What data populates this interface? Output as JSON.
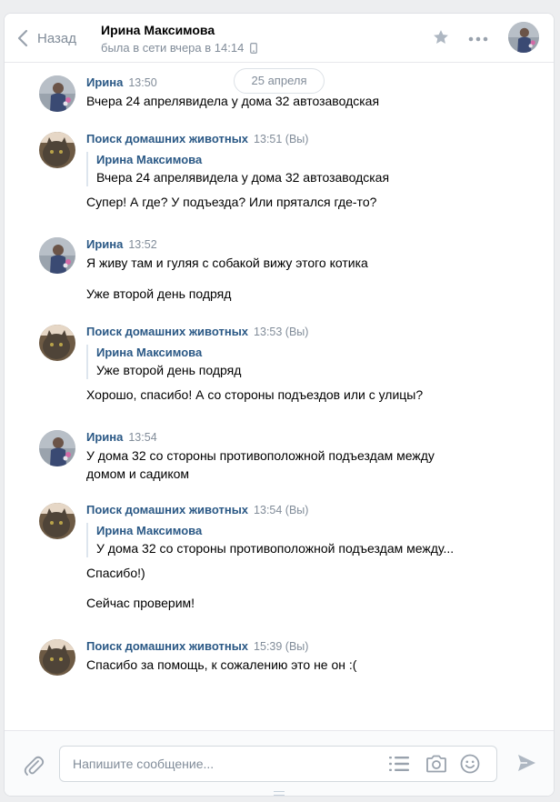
{
  "header": {
    "back_label": "Назад",
    "peer_name": "Ирина Максимова",
    "peer_status": "была в сети вчера в 14:14"
  },
  "history": {
    "date_label": "25 апреля",
    "messages": [
      {
        "author": "Ирина",
        "time": "13:50",
        "avatar": "user-photo",
        "lines": [
          "Вчера 24 апрелявидела у дома 32 автозаводская"
        ]
      },
      {
        "author": "Поиск домашних животных",
        "time": "13:51 (Вы)",
        "avatar": "cat-photo",
        "quote_author": "Ирина Максимова",
        "quote_text": "Вчера 24 апрелявидела у дома 32 автозаводская",
        "lines": [
          "Супер! А где? У подъезда? Или прятался где-то?"
        ]
      },
      {
        "author": "Ирина",
        "time": "13:52",
        "avatar": "user-photo",
        "lines": [
          "Я живу там и гуляя с собакой вижу этого котика",
          "Уже второй день подряд"
        ]
      },
      {
        "author": "Поиск домашних животных",
        "time": "13:53 (Вы)",
        "avatar": "cat-photo",
        "quote_author": "Ирина Максимова",
        "quote_text": "Уже второй день подряд",
        "lines": [
          "Хорошо, спасибо! А со стороны подъездов или с улицы?"
        ]
      },
      {
        "author": "Ирина",
        "time": "13:54",
        "avatar": "user-photo",
        "lines": [
          "У дома 32 со стороны противоположной подъездам между",
          "домом и садиком"
        ]
      },
      {
        "author": "Поиск домашних животных",
        "time": "13:54 (Вы)",
        "avatar": "cat-photo",
        "quote_author": "Ирина Максимова",
        "quote_text": "У дома 32 со стороны противоположной подъездам между...",
        "lines": [
          "Спасибо!)",
          "Сейчас проверим!"
        ]
      },
      {
        "author": "Поиск домашних животных",
        "time": "15:39 (Вы)",
        "avatar": "cat-photo",
        "lines": [
          "Спасибо за помощь, к сожалению это не он :("
        ]
      }
    ]
  },
  "composer": {
    "placeholder": "Напишите сообщение..."
  },
  "colors": {
    "link": "#2a5885",
    "muted": "#818c99",
    "background": "#edeef0"
  }
}
